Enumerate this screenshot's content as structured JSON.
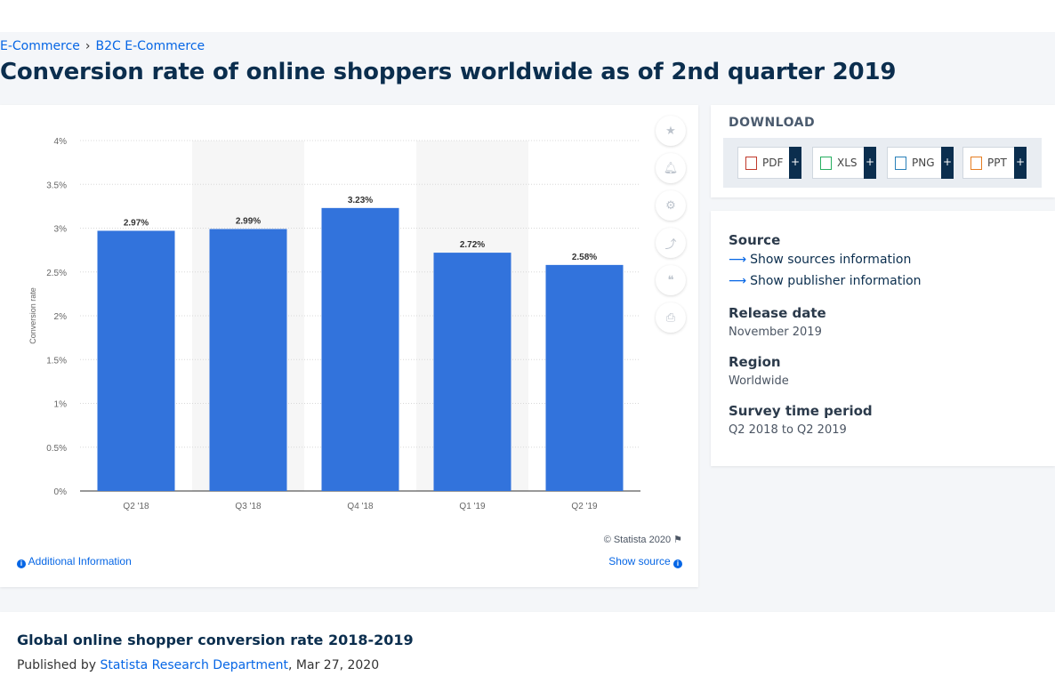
{
  "breadcrumb": [
    "E-Commerce",
    "B2C E-Commerce"
  ],
  "page_title": "Conversion rate of online shoppers worldwide as of 2nd quarter 2019",
  "chart_data": {
    "type": "bar",
    "categories": [
      "Q2 '18",
      "Q3 '18",
      "Q4 '18",
      "Q1 '19",
      "Q2 '19"
    ],
    "values": [
      2.97,
      2.99,
      3.23,
      2.72,
      2.58
    ],
    "data_labels": [
      "2.97%",
      "2.99%",
      "3.23%",
      "2.72%",
      "2.58%"
    ],
    "ylabel": "Conversion rate",
    "ylim": [
      0,
      4
    ],
    "yticks": [
      "0%",
      "0.5%",
      "1%",
      "1.5%",
      "2%",
      "2.5%",
      "3%",
      "3.5%",
      "4%"
    ],
    "grid": true,
    "bar_color": "#3273dc"
  },
  "chart_footer": {
    "copyright": "© Statista 2020",
    "additional_info": "Additional Information",
    "show_source": "Show source"
  },
  "download": {
    "title": "DOWNLOAD",
    "formats": [
      "PDF",
      "XLS",
      "PNG",
      "PPT"
    ]
  },
  "source_panel": {
    "source_heading": "Source",
    "show_sources": "Show sources information",
    "show_publisher": "Show publisher information",
    "release_heading": "Release date",
    "release_value": "November 2019",
    "region_heading": "Region",
    "region_value": "Worldwide",
    "survey_heading": "Survey time period",
    "survey_value": "Q2 2018 to Q2 2019"
  },
  "bottom": {
    "title": "Global online shopper conversion rate 2018-2019",
    "published_by": "Published by",
    "publisher": "Statista Research Department",
    "date": ", Mar 27, 2020"
  }
}
